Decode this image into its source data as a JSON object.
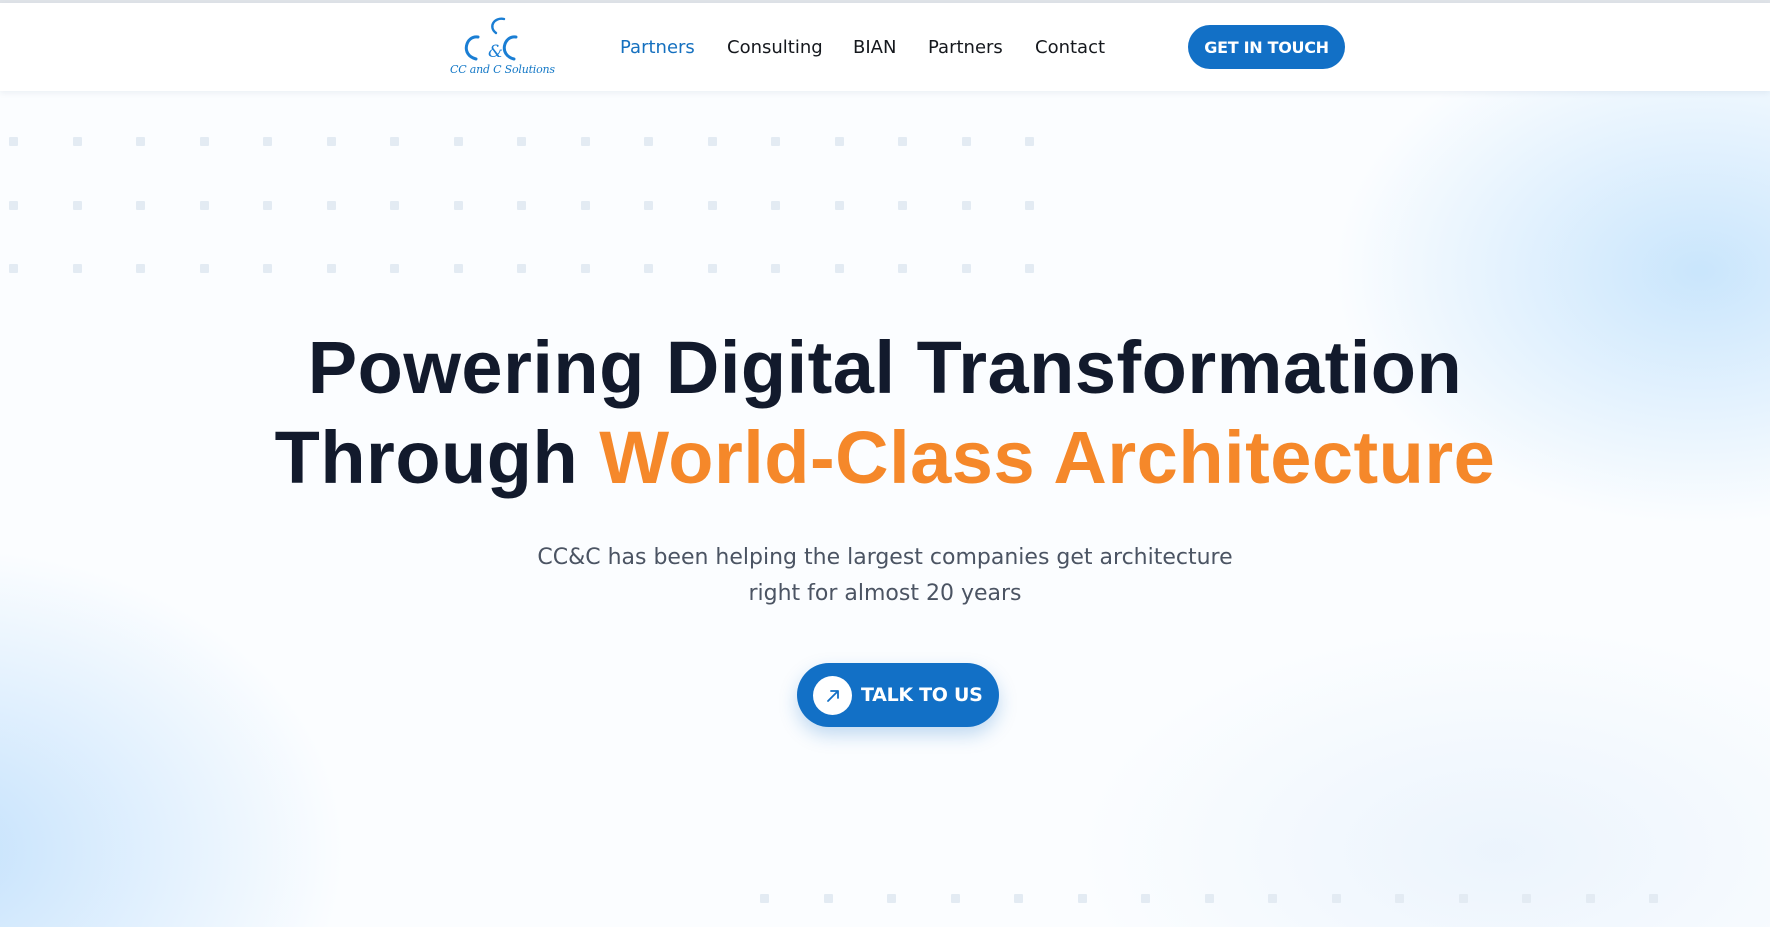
{
  "brand": {
    "logo_text": "CC and C Solutions",
    "logo_mark": "C&C",
    "primary_color": "#1270c6",
    "accent_color": "#f5882a"
  },
  "nav": {
    "items": [
      {
        "label": "Partners",
        "active": true
      },
      {
        "label": "Consulting",
        "active": false
      },
      {
        "label": "BIAN",
        "active": false
      },
      {
        "label": "Partners",
        "active": false
      },
      {
        "label": "Contact",
        "active": false
      }
    ],
    "cta_label": "GET IN TOUCH"
  },
  "hero": {
    "headline_line1": "Powering Digital Transformation",
    "headline_line2_prefix": "Through ",
    "headline_line2_accent": "World-Class Architecture",
    "subtitle_line1": "CC&C has been helping the largest companies get architecture",
    "subtitle_line2": "right for almost 20 years",
    "cta_label": "TALK TO US",
    "cta_icon": "arrow-up-right-icon"
  }
}
